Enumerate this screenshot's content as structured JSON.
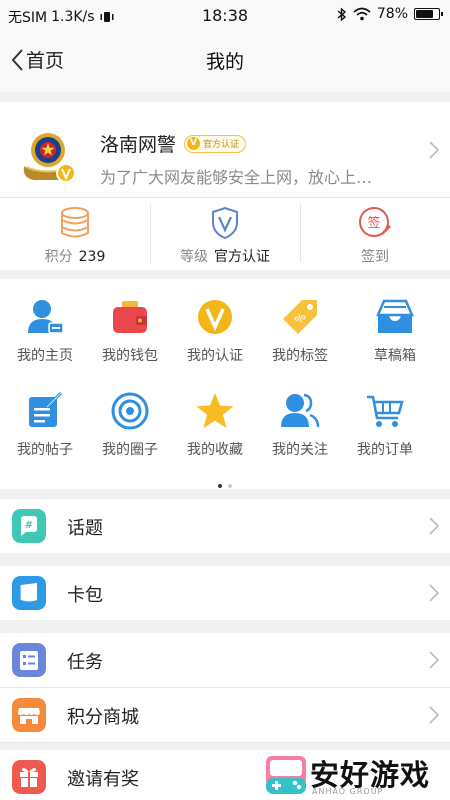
{
  "status_bar": {
    "carrier": "无SIM",
    "speed": "1.3K/s",
    "time": "18:38",
    "battery": "78%",
    "battery_level": 0.78
  },
  "nav": {
    "back_label": "首页",
    "title": "我的"
  },
  "profile": {
    "name": "洛南网警",
    "badge": "官方认证",
    "description": "为了广大网友能够安全上网，放心上…"
  },
  "stats": [
    {
      "label": "积分",
      "value": "239",
      "icon": "coins-icon",
      "color": "#f0a15a"
    },
    {
      "label": "等级",
      "value": "官方认证",
      "icon": "shield-v-icon",
      "color": "#5a86c9"
    },
    {
      "label": "签到",
      "value": "",
      "icon": "sign-in-icon",
      "color": "#e05a4f"
    }
  ],
  "grid": [
    {
      "label": "我的主页",
      "icon": "user-icon"
    },
    {
      "label": "我的钱包",
      "icon": "wallet-icon"
    },
    {
      "label": "我的认证",
      "icon": "verified-icon"
    },
    {
      "label": "我的标签",
      "icon": "tag-icon"
    },
    {
      "label": "草稿箱",
      "icon": "drafts-icon"
    },
    {
      "label": "我的帖子",
      "icon": "post-icon"
    },
    {
      "label": "我的圈子",
      "icon": "circle-icon"
    },
    {
      "label": "我的收藏",
      "icon": "star-icon"
    },
    {
      "label": "我的关注",
      "icon": "follow-icon"
    },
    {
      "label": "我的订单",
      "icon": "cart-icon"
    }
  ],
  "list": [
    {
      "label": "话题",
      "icon": "topic-icon",
      "color": "#3ec8b5"
    },
    {
      "label": "卡包",
      "icon": "card-icon",
      "color": "#2e9ae6"
    },
    {
      "label": "任务",
      "icon": "task-icon",
      "color": "#6b86db"
    },
    {
      "label": "积分商城",
      "icon": "store-icon",
      "color": "#f48a3c"
    },
    {
      "label": "邀请有奖",
      "icon": "gift-icon",
      "color": "#ee5a4f"
    }
  ],
  "watermark": {
    "text": "安好游戏",
    "sub": "ANHAO GROUP"
  }
}
